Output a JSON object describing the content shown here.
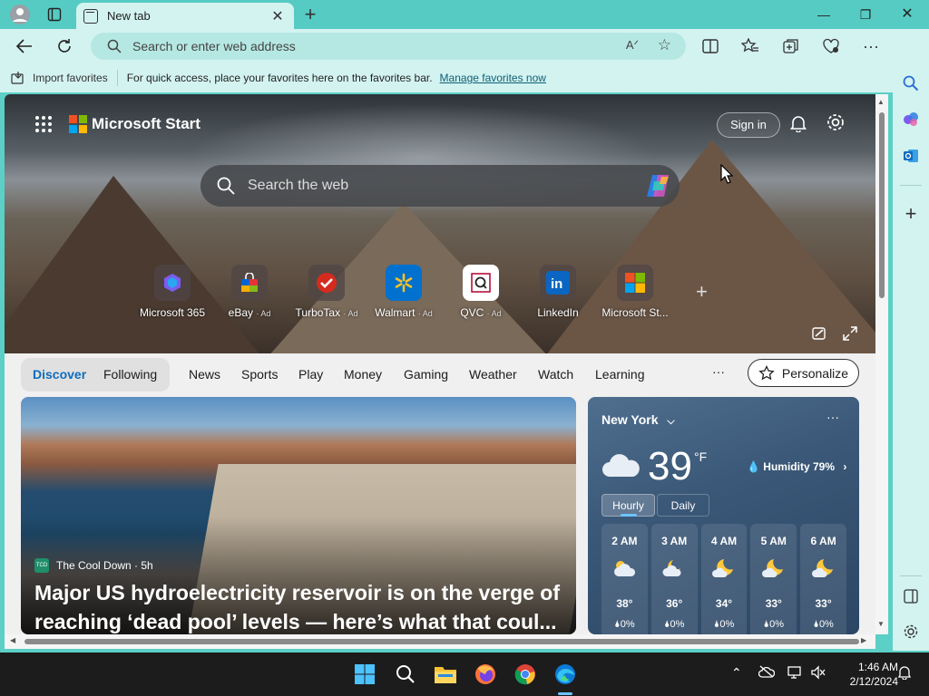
{
  "browser": {
    "tab_title": "New tab",
    "address_placeholder": "Search or enter web address",
    "read_aloud_glyph": "A"
  },
  "favorites_bar": {
    "import_label": "Import favorites",
    "message": "For quick access, place your favorites here on the favorites bar.",
    "manage_link": "Manage favorites now"
  },
  "start": {
    "brand": "Microsoft Start",
    "sign_in": "Sign in",
    "search_placeholder": "Search the web",
    "tiles": [
      {
        "label": "Microsoft 365",
        "ad": ""
      },
      {
        "label": "eBay",
        "ad": "· Ad"
      },
      {
        "label": "TurboTax",
        "ad": "· Ad"
      },
      {
        "label": "Walmart",
        "ad": "· Ad"
      },
      {
        "label": "QVC",
        "ad": "· Ad"
      },
      {
        "label": "LinkedIn",
        "ad": ""
      },
      {
        "label": "Microsoft St...",
        "ad": ""
      }
    ]
  },
  "feed_nav": {
    "items": [
      "Discover",
      "Following",
      "News",
      "Sports",
      "Play",
      "Money",
      "Gaming",
      "Weather",
      "Watch",
      "Learning"
    ],
    "active": "Discover",
    "more": "···",
    "personalize": "Personalize"
  },
  "news_card": {
    "source": "The Cool Down · 5h",
    "source_logo_text": "TCD",
    "headline": "Major US hydroelectricity reservoir is on the verge of reaching ‘dead pool’ levels — here’s what that coul..."
  },
  "weather_card": {
    "city": "New York",
    "temperature": "39",
    "unit": "°F",
    "humidity": "Humidity 79%",
    "tabs": [
      "Hourly",
      "Daily"
    ],
    "active_tab": "Hourly",
    "hours": [
      {
        "time": "2 AM",
        "temp": "38°",
        "precip": "0%",
        "icon": "partly-cloudy-icon"
      },
      {
        "time": "3 AM",
        "temp": "36°",
        "precip": "0%",
        "icon": "cloudy-moon-icon"
      },
      {
        "time": "4 AM",
        "temp": "34°",
        "precip": "0%",
        "icon": "moon-cloud-icon"
      },
      {
        "time": "5 AM",
        "temp": "33°",
        "precip": "0%",
        "icon": "moon-cloud-icon"
      },
      {
        "time": "6 AM",
        "temp": "33°",
        "precip": "0%",
        "icon": "moon-cloud-icon"
      }
    ]
  },
  "taskbar": {
    "time": "1:46 AM",
    "date": "2/12/2024"
  },
  "colors": {
    "accent": "#0f6cbd",
    "frame": "#5ccfc6",
    "toolbar": "#d3f3f0"
  }
}
